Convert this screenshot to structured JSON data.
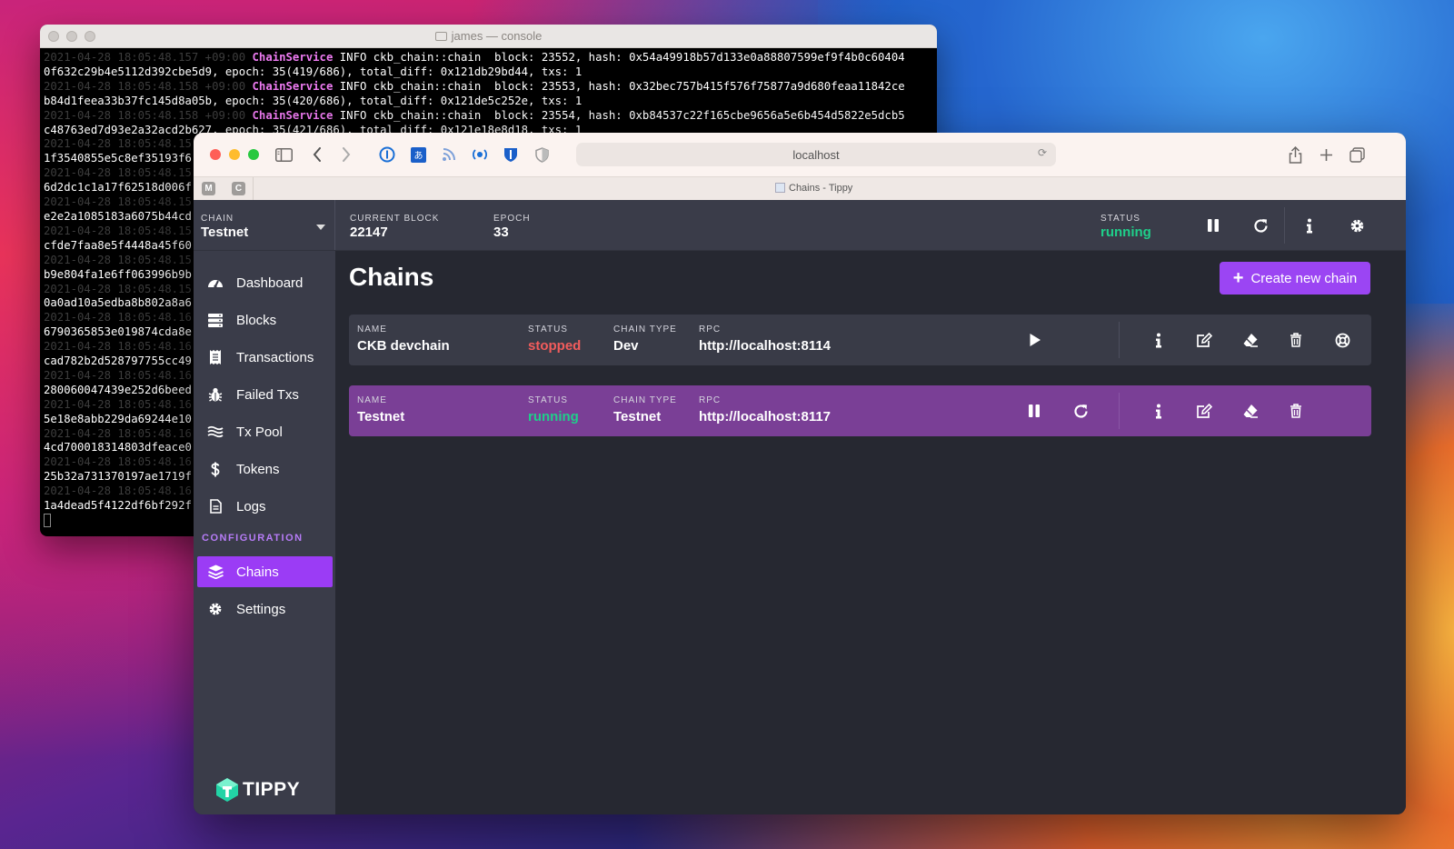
{
  "terminal": {
    "title": "james — console",
    "lines": [
      {
        "ts": "2021-04-28 18:05:48.157 +09:00",
        "svc": "ChainService",
        "msg": " INFO ckb_chain::chain  block: 23552, hash: 0x54a49918b57d133e0a88807599ef9f4b0c60404"
      },
      {
        "ts": "",
        "svc": "",
        "msg": "0f632c29b4e5112d392cbe5d9, epoch: 35(419/686), total_diff: 0x121db29bd44, txs: 1"
      },
      {
        "ts": "2021-04-28 18:05:48.158 +09:00",
        "svc": "ChainService",
        "msg": " INFO ckb_chain::chain  block: 23553, hash: 0x32bec757b415f576f75877a9d680feaa11842ce"
      },
      {
        "ts": "",
        "svc": "",
        "msg": "b84d1feea33b37fc145d8a05b, epoch: 35(420/686), total_diff: 0x121de5c252e, txs: 1"
      },
      {
        "ts": "2021-04-28 18:05:48.158 +09:00",
        "svc": "ChainService",
        "msg": " INFO ckb_chain::chain  block: 23554, hash: 0xb84537c22f165cbe9656a5e6b454d5822e5dcb5"
      },
      {
        "ts": "",
        "svc": "",
        "msg": "c48763ed7d93e2a32acd2b627, epoch: 35(421/686), total_diff: 0x121e18e8d18, txs: 1"
      },
      {
        "ts": "2021-04-28 18:05:48.15",
        "svc": "",
        "msg": ""
      },
      {
        "ts": "",
        "svc": "",
        "msg": "1f3540855e5c8ef35193f6"
      },
      {
        "ts": "2021-04-28 18:05:48.15",
        "svc": "",
        "msg": ""
      },
      {
        "ts": "",
        "svc": "",
        "msg": "6d2dc1c1a17f62518d006f"
      },
      {
        "ts": "2021-04-28 18:05:48.15",
        "svc": "",
        "msg": ""
      },
      {
        "ts": "",
        "svc": "",
        "msg": "e2e2a1085183a6075b44cd"
      },
      {
        "ts": "2021-04-28 18:05:48.15",
        "svc": "",
        "msg": ""
      },
      {
        "ts": "",
        "svc": "",
        "msg": "cfde7faa8e5f4448a45f60"
      },
      {
        "ts": "2021-04-28 18:05:48.15",
        "svc": "",
        "msg": ""
      },
      {
        "ts": "",
        "svc": "",
        "msg": "b9e804fa1e6ff063996b9b"
      },
      {
        "ts": "2021-04-28 18:05:48.15",
        "svc": "",
        "msg": ""
      },
      {
        "ts": "",
        "svc": "",
        "msg": "0a0ad10a5edba8b802a8a6"
      },
      {
        "ts": "2021-04-28 18:05:48.16",
        "svc": "",
        "msg": ""
      },
      {
        "ts": "",
        "svc": "",
        "msg": "6790365853e019874cda8e"
      },
      {
        "ts": "2021-04-28 18:05:48.16",
        "svc": "",
        "msg": ""
      },
      {
        "ts": "",
        "svc": "",
        "msg": "cad782b2d528797755cc49"
      },
      {
        "ts": "2021-04-28 18:05:48.16",
        "svc": "",
        "msg": ""
      },
      {
        "ts": "",
        "svc": "",
        "msg": "280060047439e252d6beed"
      },
      {
        "ts": "2021-04-28 18:05:48.16",
        "svc": "",
        "msg": ""
      },
      {
        "ts": "",
        "svc": "",
        "msg": "5e18e8abb229da69244e10"
      },
      {
        "ts": "2021-04-28 18:05:48.16",
        "svc": "",
        "msg": ""
      },
      {
        "ts": "",
        "svc": "",
        "msg": "4cd700018314803dfeace0"
      },
      {
        "ts": "2021-04-28 18:05:48.16",
        "svc": "",
        "msg": ""
      },
      {
        "ts": "",
        "svc": "",
        "msg": "25b32a731370197ae1719f"
      },
      {
        "ts": "2021-04-28 18:05:48.16",
        "svc": "",
        "msg": ""
      },
      {
        "ts": "",
        "svc": "",
        "msg": "1a4dead5f4122df6bf292f"
      }
    ]
  },
  "browser": {
    "url": "localhost",
    "pinned_tabs": [
      "M",
      "C"
    ],
    "tab_title": "Chains - Tippy",
    "traffic_light_colors": [
      "#fe5f57",
      "#febc2e",
      "#28c840"
    ]
  },
  "header": {
    "chain_label": "CHAIN",
    "chain_value": "Testnet",
    "current_block_label": "CURRENT BLOCK",
    "current_block_value": "22147",
    "epoch_label": "EPOCH",
    "epoch_value": "33",
    "status_label": "STATUS",
    "status_value": "running"
  },
  "sidebar": {
    "items": [
      {
        "label": "Dashboard",
        "icon": "dashboard-icon"
      },
      {
        "label": "Blocks",
        "icon": "server-icon"
      },
      {
        "label": "Transactions",
        "icon": "receipt-icon"
      },
      {
        "label": "Failed Txs",
        "icon": "bug-icon"
      },
      {
        "label": "Tx Pool",
        "icon": "water-icon"
      },
      {
        "label": "Tokens",
        "icon": "dollar-icon"
      },
      {
        "label": "Logs",
        "icon": "file-icon"
      }
    ],
    "section_label": "CONFIGURATION",
    "config_items": [
      {
        "label": "Chains",
        "icon": "layers-icon",
        "active": true
      },
      {
        "label": "Settings",
        "icon": "gear-icon",
        "active": false
      }
    ],
    "logo_text": "TIPPY"
  },
  "main": {
    "title": "Chains",
    "create_button": "Create new chain",
    "columns": {
      "name": "NAME",
      "status": "STATUS",
      "chain_type": "CHAIN TYPE",
      "rpc": "RPC"
    },
    "chains": [
      {
        "name": "CKB devchain",
        "status": "stopped",
        "chain_type": "Dev",
        "rpc": "http://localhost:8114"
      },
      {
        "name": "Testnet",
        "status": "running",
        "chain_type": "Testnet",
        "rpc": "http://localhost:8117"
      }
    ]
  },
  "colors": {
    "accent": "#9b45f3",
    "active_row": "#7a3f96",
    "running": "#1fcf8a",
    "stopped": "#f25c5c"
  }
}
